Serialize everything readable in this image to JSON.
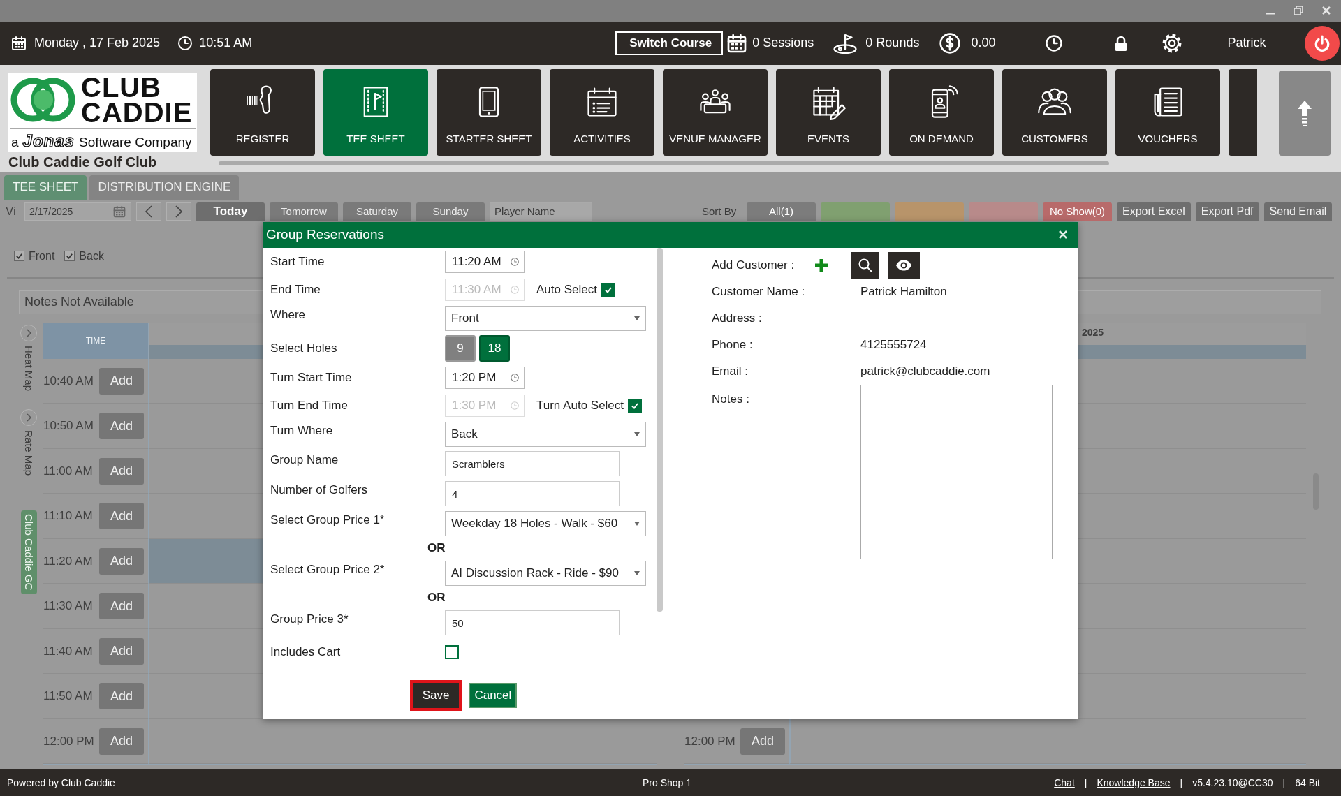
{
  "header": {
    "date": "Monday ,  17 Feb 2025",
    "time": "10:51 AM",
    "switch_course": "Switch Course",
    "sessions": "0 Sessions",
    "rounds": "0 Rounds",
    "balance": "0.00",
    "user": "Patrick"
  },
  "logo": {
    "line_1": "CLUB",
    "line_2": "CADDIE",
    "prefix": "a",
    "maker": "Jonas",
    "suffix": "Software Company"
  },
  "club_name": "Club Caddie Golf Club",
  "nav": [
    {
      "kind": "register",
      "label": "REGISTER",
      "selected": false
    },
    {
      "kind": "tee_sheet",
      "label": "TEE SHEET",
      "selected": true
    },
    {
      "kind": "starter_sheet",
      "label": "STARTER SHEET",
      "selected": false
    },
    {
      "kind": "activities",
      "label": "ACTIVITIES",
      "selected": false
    },
    {
      "kind": "venue_manager",
      "label": "VENUE MANAGER",
      "selected": false
    },
    {
      "kind": "events",
      "label": "EVENTS",
      "selected": false
    },
    {
      "kind": "on_demand",
      "label": "ON DEMAND",
      "selected": false
    },
    {
      "kind": "customers",
      "label": "CUSTOMERS",
      "selected": false
    },
    {
      "kind": "vouchers",
      "label": "VOUCHERS",
      "selected": false
    },
    {
      "kind": "cut",
      "selected": false
    }
  ],
  "tabs": [
    {
      "label": "TEE SHEET",
      "selected": true
    },
    {
      "label": "DISTRIBUTION ENGINE",
      "selected": false
    }
  ],
  "toolbar": {
    "view_label": "Vi",
    "date": "2/17/2025",
    "days": [
      {
        "label": "Today",
        "selected": true
      },
      {
        "label": "Tomorrow",
        "selected": false
      },
      {
        "label": "Saturday",
        "selected": false
      },
      {
        "label": "Sunday",
        "selected": false
      }
    ],
    "player_placeholder": "Player Name",
    "sort_label": "Sort By",
    "filters": [
      {
        "label": "All(1)",
        "color": "#7c7c7c"
      },
      {
        "color": "#80a070"
      },
      {
        "color": "#b8946a"
      },
      {
        "color": "#b88a8a"
      },
      {
        "label": "No Show(0)",
        "color": "#b86a6a"
      }
    ],
    "actions": [
      "Export Excel",
      "Export Pdf",
      "Send Email"
    ]
  },
  "holes": [
    {
      "label": "Front",
      "checked": true
    },
    {
      "label": "Back",
      "checked": true
    }
  ],
  "notes_banner": "Notes Not Available",
  "side_tabs": [
    {
      "kind": "map",
      "label": "Heat Map",
      "selected": false
    },
    {
      "kind": "map",
      "label": "Rate Map",
      "selected": false
    },
    {
      "kind": "course",
      "label": "Club Caddie GC",
      "selected": true
    }
  ],
  "tee_grid": {
    "time_header": "TIME",
    "rows": [
      {
        "time": "10:40 AM",
        "action": "Add",
        "highlighted": false
      },
      {
        "time": "10:50 AM",
        "action": "Add",
        "highlighted": false
      },
      {
        "time": "11:00 AM",
        "action": "Add",
        "highlighted": false
      },
      {
        "time": "11:10 AM",
        "action": "Add",
        "highlighted": false
      },
      {
        "time": "11:20 AM",
        "action": "Add",
        "highlighted": true
      },
      {
        "time": "11:30 AM",
        "action": "Add",
        "highlighted": false
      },
      {
        "time": "11:40 AM",
        "action": "Add",
        "highlighted": false
      },
      {
        "time": "11:50 AM",
        "action": "Add",
        "highlighted": false
      },
      {
        "time": "12:00 PM",
        "action": "Add",
        "highlighted": false
      }
    ]
  },
  "second_grid": {
    "date_header": "2025",
    "rows": [
      {
        "time": "12:00 PM",
        "action": "Add"
      }
    ]
  },
  "dialog": {
    "title": "Group Reservations",
    "form": [
      {
        "kind": "time",
        "label": "Start Time",
        "value": "11:20 AM",
        "disabled": false
      },
      {
        "kind": "time",
        "label": "End Time",
        "value": "11:30 AM",
        "disabled": true,
        "check_label": "Auto Select",
        "checked": true
      },
      {
        "kind": "select",
        "label": "Where",
        "value": "Front"
      },
      {
        "kind": "holes",
        "label": "Select Holes",
        "options": [
          {
            "label": "9",
            "selected": false
          },
          {
            "label": "18",
            "selected": true
          }
        ]
      },
      {
        "kind": "time",
        "label": "Turn Start Time",
        "value": "1:20 PM",
        "disabled": false
      },
      {
        "kind": "time",
        "label": "Turn End Time",
        "value": "1:30 PM",
        "disabled": true,
        "check_label": "Turn Auto Select",
        "checked": true
      },
      {
        "kind": "select",
        "label": "Turn Where",
        "value": "Back"
      },
      {
        "kind": "text",
        "label": "Group Name",
        "value": "Scramblers"
      },
      {
        "kind": "text",
        "label": "Number of Golfers",
        "value": "4"
      },
      {
        "kind": "select",
        "label": "Select Group Price 1*",
        "value": "Weekday 18 Holes - Walk - $60"
      },
      {
        "kind": "or",
        "label": "OR"
      },
      {
        "kind": "select",
        "label": "Select Group Price 2*",
        "value": "AI Discussion Rack - Ride - $90"
      },
      {
        "kind": "or",
        "label": "OR"
      },
      {
        "kind": "text",
        "label": "Group Price 3*",
        "value": "50"
      },
      {
        "kind": "checkbox",
        "label": "Includes Cart",
        "checked": false
      }
    ],
    "save": {
      "label": "Save",
      "focused": true
    },
    "cancel": "Cancel",
    "customer": {
      "add_label": "Add Customer :",
      "rows": [
        {
          "label": "Customer Name :",
          "value": "Patrick Hamilton"
        },
        {
          "label": "Address :"
        },
        {
          "label": "Phone :",
          "value": "4125555724"
        },
        {
          "label": "Email :",
          "value": "patrick@clubcaddie.com"
        }
      ],
      "notes_label": "Notes :"
    }
  },
  "footer": {
    "left": "Powered by Club Caddie",
    "center": "Pro Shop 1",
    "right": [
      {
        "kind": "link",
        "text": "Chat"
      },
      {
        "kind": "separator",
        "text": "|"
      },
      {
        "kind": "link",
        "text": "Knowledge Base"
      },
      {
        "kind": "separator",
        "text": "|"
      },
      {
        "kind": "text",
        "text": "v5.4.23.10@CC30"
      },
      {
        "kind": "separator",
        "text": "|"
      },
      {
        "kind": "text",
        "text": "64 Bit"
      }
    ]
  }
}
